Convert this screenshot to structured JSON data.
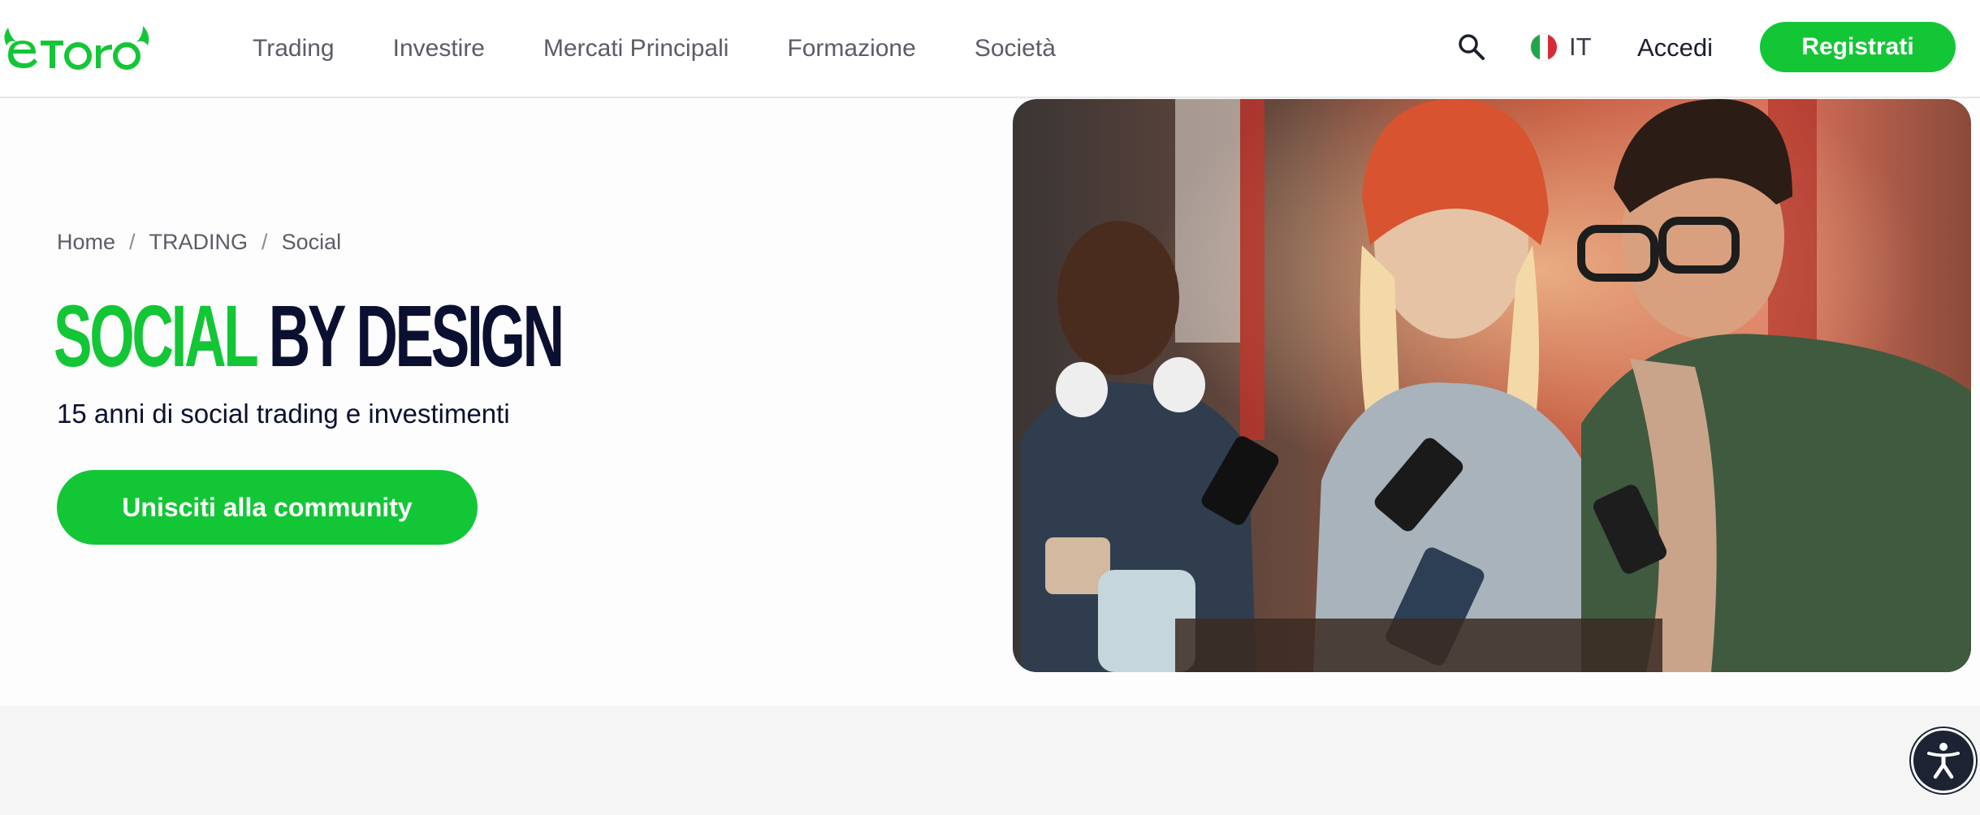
{
  "brand": {
    "logo_text": "eToro",
    "accent_color": "#13c636",
    "dark_color": "#0b1030"
  },
  "nav": {
    "items": [
      "Trading",
      "Investire",
      "Mercati Principali",
      "Formazione",
      "Società"
    ]
  },
  "header": {
    "search_icon": "search-icon",
    "language": {
      "code": "IT",
      "flag": "italy-flag-icon"
    },
    "login_label": "Accedi",
    "register_label": "Registrati"
  },
  "breadcrumb": {
    "items": [
      "Home",
      "TRADING",
      "Social"
    ],
    "separator": "/"
  },
  "hero": {
    "title_highlight": "SOCIAL",
    "title_rest": "BY DESIGN",
    "subtitle": "15 anni di social trading e investimenti",
    "cta_label": "Unisciti alla community"
  },
  "accessibility": {
    "icon": "accessibility-icon"
  }
}
